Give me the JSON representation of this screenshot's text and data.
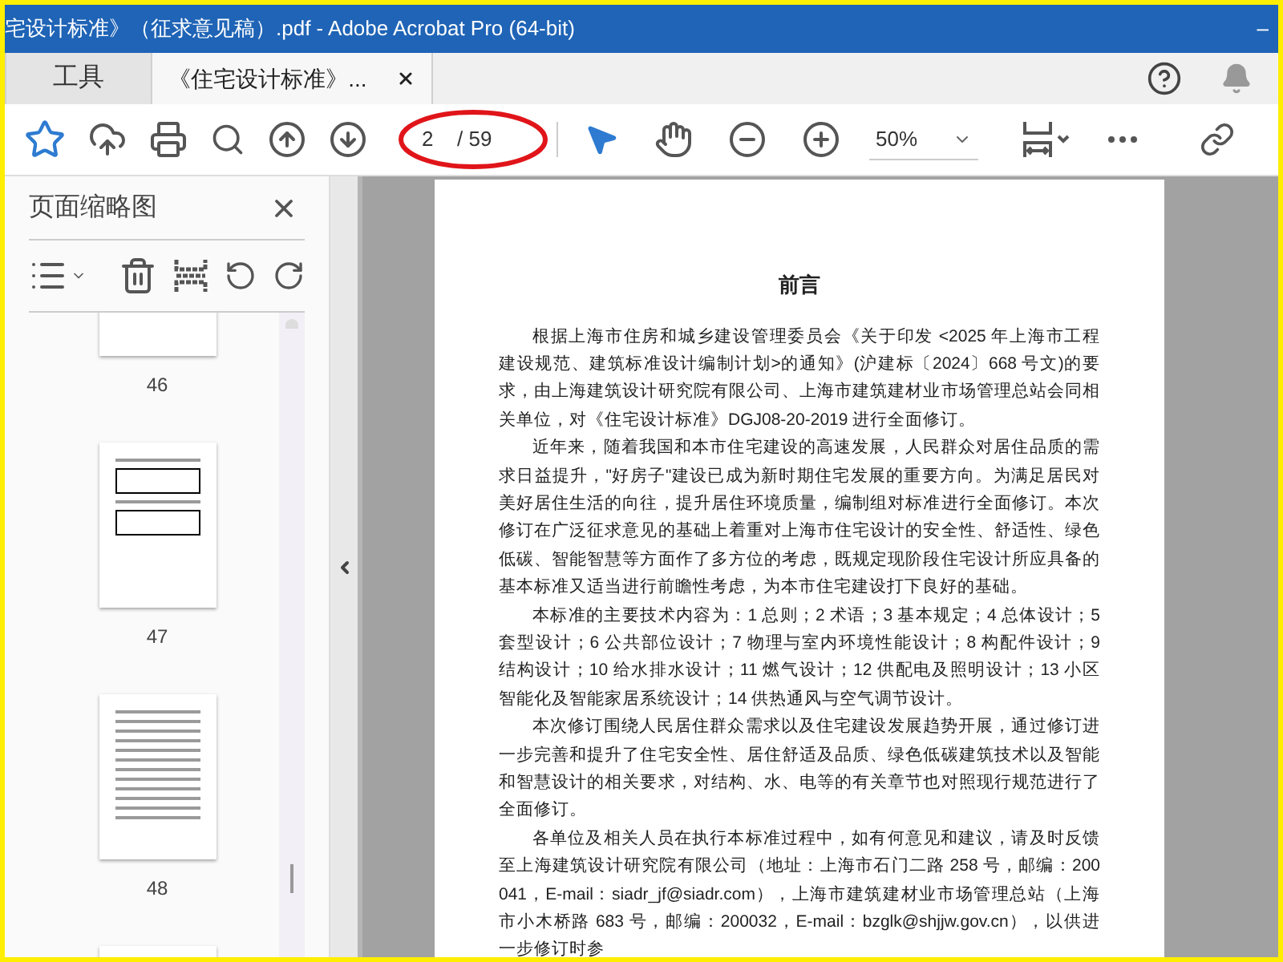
{
  "window": {
    "title": "宅设计标准》（征求意见稿）.pdf - Adobe Acrobat Pro (64-bit)",
    "minimize": "–"
  },
  "tabs": [
    {
      "label": "工具",
      "selected": false,
      "kind": "tool"
    },
    {
      "label": "《住宅设计标准》...",
      "selected": true,
      "kind": "document"
    }
  ],
  "toolbar": {
    "page_field": {
      "value": "2"
    },
    "page_total": "/ 59",
    "zoom": "50%"
  },
  "sidebar": {
    "title": "页面缩略图",
    "thumbnails": [
      {
        "label": "46",
        "kind": "cut-top"
      },
      {
        "label": "47",
        "kind": "tables"
      },
      {
        "label": "48",
        "kind": "text"
      },
      {
        "kind": "cut-bottom"
      }
    ]
  },
  "document": {
    "heading": "前言",
    "paragraphs": [
      "根据上海市住房和城乡建设管理委员会《关于印发 <2025 年上海市工程建设规范、建筑标准设计编制计划>的通知》(沪建标〔2024〕668 号文)的要求，由上海建筑设计研究院有限公司、上海市建筑建材业市场管理总站会同相关单位，对《住宅设计标准》DGJ08-20-2019 进行全面修订。",
      "近年来，随着我国和本市住宅建设的高速发展，人民群众对居住品质的需求日益提升，\"好房子\"建设已成为新时期住宅发展的重要方向。为满足居民对美好居住生活的向往，提升居住环境质量，编制组对标准进行全面修订。本次修订在广泛征求意见的基础上着重对上海市住宅设计的安全性、舒适性、绿色低碳、智能智慧等方面作了多方位的考虑，既规定现阶段住宅设计所应具备的基本标准又适当进行前瞻性考虑，为本市住宅建设打下良好的基础。",
      "本标准的主要技术内容为：1 总则；2 术语；3 基本规定；4 总体设计；5 套型设计；6 公共部位设计；7 物理与室内环境性能设计；8 构配件设计；9 结构设计；10 给水排水设计；11 燃气设计；12 供配电及照明设计；13 小区智能化及智能家居系统设计；14 供热通风与空气调节设计。",
      "本次修订围绕人民居住群众需求以及住宅建设发展趋势开展，通过修订进一步完善和提升了住宅安全性、居住舒适及品质、绿色低碳建筑技术以及智能和智慧设计的相关要求，对结构、水、电等的有关章节也对照现行规范进行了全面修订。",
      "各单位及相关人员在执行本标准过程中，如有何意见和建议，请及时反馈至上海建筑设计研究院有限公司（地址：上海市石门二路 258 号，邮编：200041，E-mail：siadr_jf@siadr.com），上海市建筑建材业市场管理总站（上海市小木桥路 683 号，邮编：200032，E-mail：bzglk@shjjw.gov.cn），以供进一步修订时参"
    ]
  }
}
